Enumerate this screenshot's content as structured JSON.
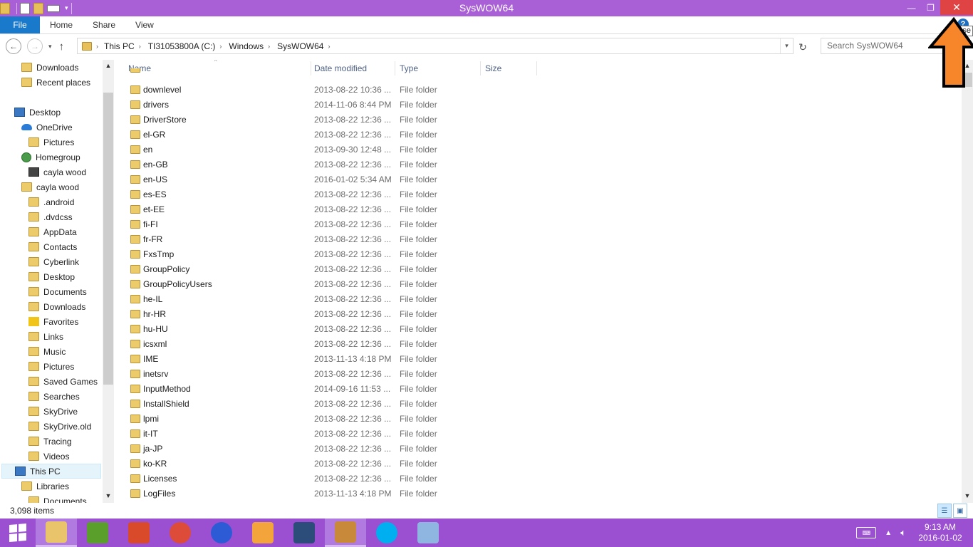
{
  "window": {
    "title": "SysWOW64",
    "tooltip": "se"
  },
  "ribbon": {
    "tabs": [
      "File",
      "Home",
      "Share",
      "View"
    ]
  },
  "address": {
    "crumbs": [
      "This PC",
      "TI31053800A (C:)",
      "Windows",
      "SysWOW64"
    ],
    "search_placeholder": "Search SysWOW64"
  },
  "nav": {
    "items": [
      {
        "label": "Downloads",
        "icon": "folder-icon"
      },
      {
        "label": "Recent places",
        "icon": "recent-icon"
      },
      {
        "label": "Desktop",
        "icon": "monitor-icon"
      },
      {
        "label": "OneDrive",
        "icon": "cloud-icon"
      },
      {
        "label": "Pictures",
        "icon": "folder-icon"
      },
      {
        "label": "Homegroup",
        "icon": "globe-icon"
      },
      {
        "label": "cayla wood",
        "icon": "photo-icon"
      },
      {
        "label": "cayla wood",
        "icon": "folder-icon"
      },
      {
        "label": ".android",
        "icon": "folder-icon"
      },
      {
        "label": ".dvdcss",
        "icon": "folder-icon"
      },
      {
        "label": "AppData",
        "icon": "folder-icon"
      },
      {
        "label": "Contacts",
        "icon": "folder-icon"
      },
      {
        "label": "Cyberlink",
        "icon": "folder-icon"
      },
      {
        "label": "Desktop",
        "icon": "folder-icon"
      },
      {
        "label": "Documents",
        "icon": "folder-icon"
      },
      {
        "label": "Downloads",
        "icon": "folder-icon"
      },
      {
        "label": "Favorites",
        "icon": "star-icon"
      },
      {
        "label": "Links",
        "icon": "folder-icon"
      },
      {
        "label": "Music",
        "icon": "folder-icon"
      },
      {
        "label": "Pictures",
        "icon": "folder-icon"
      },
      {
        "label": "Saved Games",
        "icon": "folder-icon"
      },
      {
        "label": "Searches",
        "icon": "folder-icon"
      },
      {
        "label": "SkyDrive",
        "icon": "folder-icon"
      },
      {
        "label": "SkyDrive.old",
        "icon": "folder-icon"
      },
      {
        "label": "Tracing",
        "icon": "folder-icon"
      },
      {
        "label": "Videos",
        "icon": "folder-icon"
      },
      {
        "label": "This PC",
        "icon": "monitor-icon"
      },
      {
        "label": "Libraries",
        "icon": "folder-icon"
      },
      {
        "label": "Documents",
        "icon": "folder-icon"
      }
    ]
  },
  "list": {
    "columns": [
      "Name",
      "Date modified",
      "Type",
      "Size"
    ],
    "rows": [
      {
        "name": "downlevel",
        "date": "2013-08-22 10:36 ...",
        "type": "File folder"
      },
      {
        "name": "drivers",
        "date": "2014-11-06 8:44 PM",
        "type": "File folder"
      },
      {
        "name": "DriverStore",
        "date": "2013-08-22 12:36 ...",
        "type": "File folder"
      },
      {
        "name": "el-GR",
        "date": "2013-08-22 12:36 ...",
        "type": "File folder"
      },
      {
        "name": "en",
        "date": "2013-09-30 12:48 ...",
        "type": "File folder"
      },
      {
        "name": "en-GB",
        "date": "2013-08-22 12:36 ...",
        "type": "File folder"
      },
      {
        "name": "en-US",
        "date": "2016-01-02 5:34 AM",
        "type": "File folder"
      },
      {
        "name": "es-ES",
        "date": "2013-08-22 12:36 ...",
        "type": "File folder"
      },
      {
        "name": "et-EE",
        "date": "2013-08-22 12:36 ...",
        "type": "File folder"
      },
      {
        "name": "fi-FI",
        "date": "2013-08-22 12:36 ...",
        "type": "File folder"
      },
      {
        "name": "fr-FR",
        "date": "2013-08-22 12:36 ...",
        "type": "File folder"
      },
      {
        "name": "FxsTmp",
        "date": "2013-08-22 12:36 ...",
        "type": "File folder"
      },
      {
        "name": "GroupPolicy",
        "date": "2013-08-22 12:36 ...",
        "type": "File folder"
      },
      {
        "name": "GroupPolicyUsers",
        "date": "2013-08-22 12:36 ...",
        "type": "File folder"
      },
      {
        "name": "he-IL",
        "date": "2013-08-22 12:36 ...",
        "type": "File folder"
      },
      {
        "name": "hr-HR",
        "date": "2013-08-22 12:36 ...",
        "type": "File folder"
      },
      {
        "name": "hu-HU",
        "date": "2013-08-22 12:36 ...",
        "type": "File folder"
      },
      {
        "name": "icsxml",
        "date": "2013-08-22 12:36 ...",
        "type": "File folder"
      },
      {
        "name": "IME",
        "date": "2013-11-13 4:18 PM",
        "type": "File folder"
      },
      {
        "name": "inetsrv",
        "date": "2013-08-22 12:36 ...",
        "type": "File folder"
      },
      {
        "name": "InputMethod",
        "date": "2014-09-16 11:53 ...",
        "type": "File folder"
      },
      {
        "name": "InstallShield",
        "date": "2013-08-22 12:36 ...",
        "type": "File folder"
      },
      {
        "name": "lpmi",
        "date": "2013-08-22 12:36 ...",
        "type": "File folder"
      },
      {
        "name": "it-IT",
        "date": "2013-08-22 12:36 ...",
        "type": "File folder"
      },
      {
        "name": "ja-JP",
        "date": "2013-08-22 12:36 ...",
        "type": "File folder"
      },
      {
        "name": "ko-KR",
        "date": "2013-08-22 12:36 ...",
        "type": "File folder"
      },
      {
        "name": "Licenses",
        "date": "2013-08-22 12:36 ...",
        "type": "File folder"
      },
      {
        "name": "LogFiles",
        "date": "2013-11-13 4:18 PM",
        "type": "File folder"
      }
    ]
  },
  "status": {
    "count": "3,098 items"
  },
  "taskbar": {
    "apps": [
      {
        "name": "file-explorer",
        "color": "#e9c46a",
        "active": true
      },
      {
        "name": "word-app",
        "color": "#5a9e2c",
        "active": false
      },
      {
        "name": "colorful-app",
        "color": "#d84a2a",
        "active": false
      },
      {
        "name": "chrome",
        "color": "#dd4b39",
        "active": false
      },
      {
        "name": "shield-app",
        "color": "#2d5bd6",
        "active": false
      },
      {
        "name": "media-app",
        "color": "#f3a43b",
        "active": false
      },
      {
        "name": "film-app",
        "color": "#2c4c7a",
        "active": false
      },
      {
        "name": "museum-app",
        "color": "#c88a3a",
        "active": true
      },
      {
        "name": "skype",
        "color": "#00aff0",
        "active": false
      },
      {
        "name": "paint-app",
        "color": "#8fb6e0",
        "active": false
      }
    ],
    "time": "9:13 AM",
    "date": "2016-01-02"
  },
  "colors": {
    "titlebar": "#a95fd6",
    "taskbar": "#9b4fd1",
    "close": "#e04343",
    "file_tab": "#1979ca",
    "annotation_arrow": "#f7862a"
  }
}
